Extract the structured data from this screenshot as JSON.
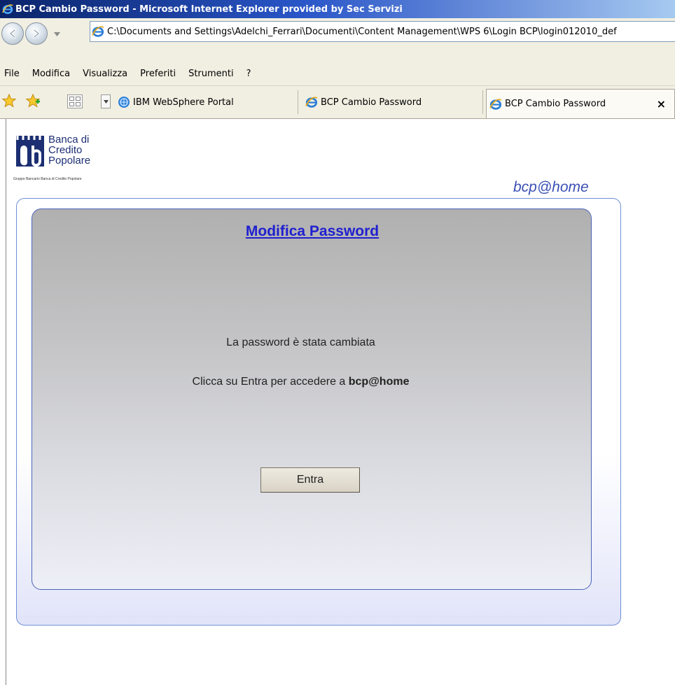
{
  "window": {
    "title": "BCP Cambio Password - Microsoft Internet Explorer provided by Sec Servizi"
  },
  "address_bar": {
    "value": "C:\\Documents and Settings\\Adelchi_Ferrari\\Documenti\\Content Management\\WPS 6\\Login BCP\\login012010_def"
  },
  "menu": {
    "items": [
      "File",
      "Modifica",
      "Visualizza",
      "Preferiti",
      "Strumenti",
      "?"
    ]
  },
  "tabs": [
    {
      "label": "IBM WebSphere Portal",
      "icon": "websphere-icon",
      "active": false
    },
    {
      "label": "BCP Cambio Password",
      "icon": "ie-icon",
      "active": false
    },
    {
      "label": "BCP Cambio Password",
      "icon": "ie-icon",
      "active": true
    }
  ],
  "tab_close_label": "×",
  "page": {
    "logo": {
      "lines": [
        "Banca di",
        "Credito",
        "Popolare"
      ],
      "subtitle": "Gruppo Bancario Banca di Credito Popolare"
    },
    "brand_tag": "bcp@home",
    "panel_title": "Modifica Password",
    "message_1": "La password è stata cambiata",
    "message_2_prefix": "Clicca su Entra per accedere a ",
    "message_2_bold": "bcp@home",
    "enter_button": "Entra"
  },
  "colors": {
    "title_bar_start": "#0a246a",
    "toolbar_bg": "#f1efe2",
    "panel_border": "#4a64b8",
    "title_link": "#1f1fd0",
    "brand_tag": "#3b4fb4"
  }
}
